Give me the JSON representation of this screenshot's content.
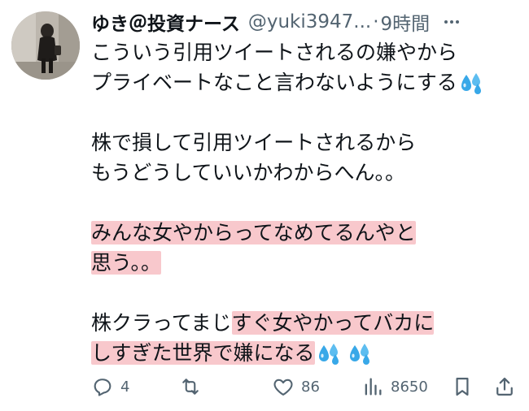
{
  "tweet": {
    "display_name": "ゆき＠投資ナース",
    "handle": "@yuki3947...",
    "separator": "·",
    "time": "9時間",
    "icons": {
      "avatar": "profile-photo",
      "more": "more-icon",
      "emoji": "sweat-droplets-emoji"
    },
    "lines": [
      {
        "parts": [
          {
            "text": "こういう引用ツイートされるの嫌やから"
          }
        ]
      },
      {
        "parts": [
          {
            "text": "プライベートなこと言わないようにする"
          }
        ],
        "emoji": 1
      },
      {
        "blank": true
      },
      {
        "parts": [
          {
            "text": "株で損して引用ツイートされるから"
          }
        ]
      },
      {
        "parts": [
          {
            "text": "もうどうしていいかわからへん。。"
          }
        ]
      },
      {
        "blank": true
      },
      {
        "parts": [
          {
            "text": "みんな女やからってなめてるんやと",
            "highlight": true
          }
        ]
      },
      {
        "parts": [
          {
            "text": "思う。。",
            "highlight": true
          }
        ]
      },
      {
        "blank": true
      },
      {
        "parts": [
          {
            "text": "株クラってまじ"
          },
          {
            "text": "すぐ女やかってバカに",
            "highlight": true
          }
        ]
      },
      {
        "parts": [
          {
            "text": "しすぎた世界で嫌になる",
            "highlight": true
          }
        ],
        "emoji": 2
      }
    ],
    "highlight_color": "#f8c8cc",
    "actions": {
      "reply_count": "4",
      "retweet_count": "",
      "like_count": "86",
      "views_count": "8650"
    }
  }
}
